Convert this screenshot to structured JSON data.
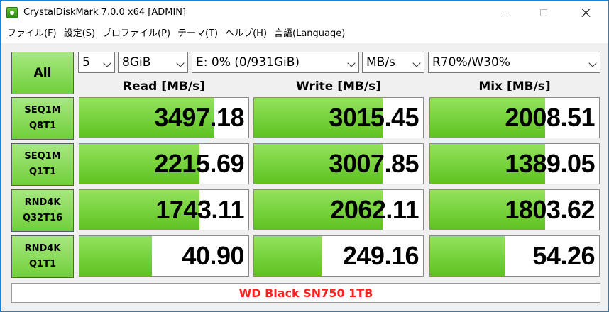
{
  "window": {
    "title": "CrystalDiskMark 7.0.0 x64 [ADMIN]"
  },
  "menu": [
    "ファイル(F)",
    "設定(S)",
    "プロファイル(P)",
    "テーマ(T)",
    "ヘルプ(H)",
    "言語(Language)"
  ],
  "controls": {
    "all_label": "All",
    "test_count": "5",
    "test_size": "8GiB",
    "drive": "E: 0% (0/931GiB)",
    "unit": "MB/s",
    "mix_ratio": "R70%/W30%"
  },
  "headers": {
    "read": "Read [MB/s]",
    "write": "Write [MB/s]",
    "mix": "Mix [MB/s]"
  },
  "colors": {
    "accent_green": "#71cf3a",
    "bar_green": "#5fc221",
    "comment_red": "#ff2020"
  },
  "tests": [
    {
      "line1": "SEQ1M",
      "line2": "Q8T1",
      "read": "3497.18",
      "write": "3015.45",
      "mix": "2008.51",
      "read_level": 0.8,
      "write_level": 0.76,
      "mix_level": 0.68
    },
    {
      "line1": "SEQ1M",
      "line2": "Q1T1",
      "read": "2215.69",
      "write": "3007.85",
      "mix": "1389.05",
      "read_level": 0.71,
      "write_level": 0.76,
      "mix_level": 0.68
    },
    {
      "line1": "RND4K",
      "line2": "Q32T16",
      "read": "1743.11",
      "write": "2062.11",
      "mix": "1803.62",
      "read_level": 0.71,
      "write_level": 0.76,
      "mix_level": 0.68
    },
    {
      "line1": "RND4K",
      "line2": "Q1T1",
      "read": "40.90",
      "write": "249.16",
      "mix": "54.26",
      "read_level": 0.43,
      "write_level": 0.4,
      "mix_level": 0.44
    }
  ],
  "comment": "WD Black SN750 1TB"
}
